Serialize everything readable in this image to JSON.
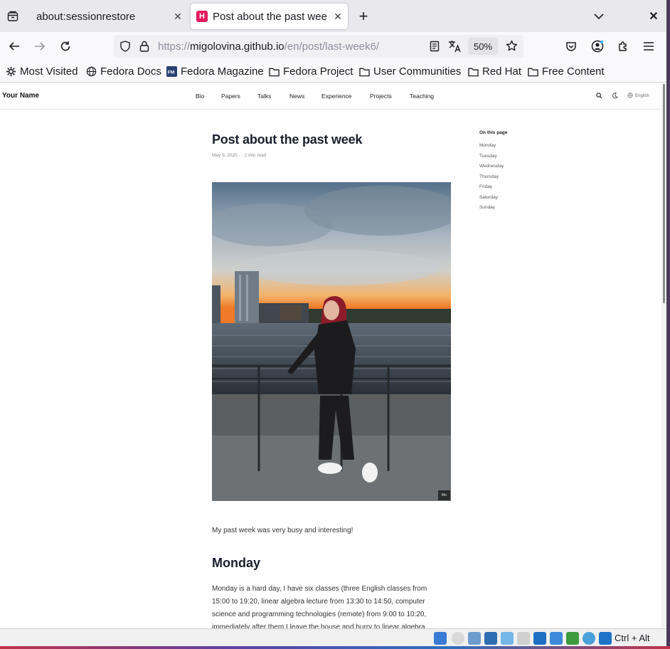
{
  "tabs": [
    {
      "title": "about:sessionrestore",
      "active": false
    },
    {
      "title": "Post about the past week",
      "active": true,
      "favicon": "H"
    }
  ],
  "url": {
    "scheme": "https://",
    "host": "migolovina.github.io",
    "path": "/en/post/last-week6/"
  },
  "zoom": "50%",
  "bookmarks": [
    {
      "label": "Most Visited",
      "icon": "gear-icon"
    },
    {
      "label": "Fedora Docs",
      "icon": "globe-icon"
    },
    {
      "label": "Fedora Magazine",
      "icon": "fm-icon"
    },
    {
      "label": "Fedora Project",
      "icon": "folder-icon"
    },
    {
      "label": "User Communities",
      "icon": "folder-icon"
    },
    {
      "label": "Red Hat",
      "icon": "folder-icon"
    },
    {
      "label": "Free Content",
      "icon": "folder-icon"
    }
  ],
  "site": {
    "brand": "Your Name",
    "nav": [
      "Bio",
      "Papers",
      "Talks",
      "News",
      "Experience",
      "Projects",
      "Teaching"
    ],
    "language": "English"
  },
  "post": {
    "title": "Post about the past week",
    "meta": "May 9, 2025  ·  ·  2 min read",
    "image_caption": "Me",
    "intro": "My past week was very busy and interesting!",
    "section_heading": "Monday",
    "paragraph_lines": [
      "Monday is a hard day, I have six classes (three English classes from",
      "15:00 to 19:20, linear algebra lecture from 13:30 to 14:50, computer",
      "science and programming technologies (remote) from 9:00 to 10:20,",
      "immediately after them I leave the house and hurry to linear algebra"
    ]
  },
  "toc": {
    "title": "On this page",
    "items": [
      "Monday",
      "Tuesday",
      "Wednesday",
      "Thursday",
      "Friday",
      "Saturday",
      "Sunday"
    ]
  },
  "statusbar": {
    "keys": "Ctrl + Alt"
  },
  "colors": {
    "accent_favicon": "#e5185c",
    "heading": "#1a1f2c"
  }
}
